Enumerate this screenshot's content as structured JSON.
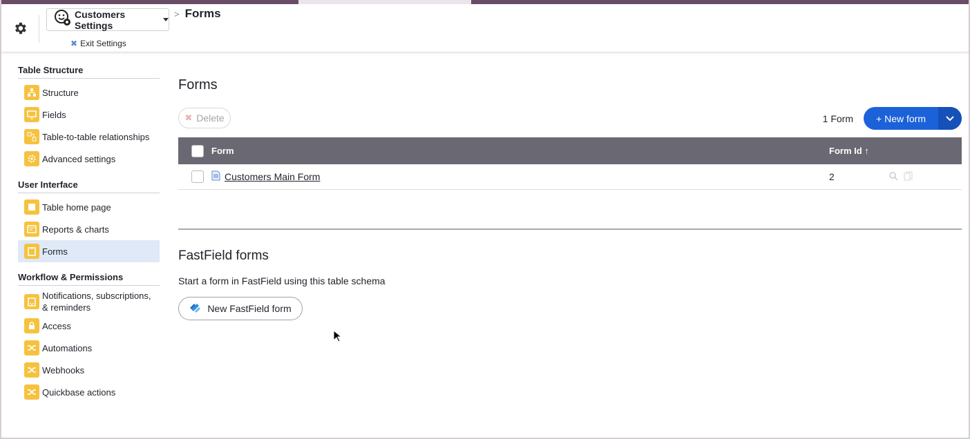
{
  "header": {
    "app_name": "Customers Settings",
    "exit_label": "Exit Settings",
    "breadcrumb_separator": ">",
    "breadcrumb_current": "Forms"
  },
  "sidebar": {
    "sections": [
      {
        "title": "Table Structure",
        "items": [
          {
            "label": "Structure",
            "icon": "structure-icon"
          },
          {
            "label": "Fields",
            "icon": "fields-icon"
          },
          {
            "label": "Table-to-table relationships",
            "icon": "relationships-icon"
          },
          {
            "label": "Advanced settings",
            "icon": "settings-gear-icon"
          }
        ]
      },
      {
        "title": "User Interface",
        "items": [
          {
            "label": "Table home page",
            "icon": "home-page-icon"
          },
          {
            "label": "Reports & charts",
            "icon": "reports-icon"
          },
          {
            "label": "Forms",
            "icon": "forms-icon",
            "active": true
          }
        ]
      },
      {
        "title": "Workflow & Permissions",
        "items": [
          {
            "label": "Notifications, subscriptions,",
            "label2": "& reminders",
            "icon": "notifications-icon"
          },
          {
            "label": "Access",
            "icon": "access-icon"
          },
          {
            "label": "Automations",
            "icon": "automations-icon"
          },
          {
            "label": "Webhooks",
            "icon": "webhooks-icon"
          },
          {
            "label": "Quickbase actions",
            "icon": "quickbase-actions-icon"
          }
        ]
      }
    ]
  },
  "main": {
    "title": "Forms",
    "delete_label": "Delete",
    "form_count": "1 Form",
    "new_form_label": "+ New form",
    "table": {
      "columns": [
        "Form",
        "Form Id"
      ],
      "sort_indicator": "↑",
      "rows": [
        {
          "name": "Customers Main Form",
          "id": "2"
        }
      ]
    },
    "fastfield": {
      "title": "FastField forms",
      "description": "Start a form in FastField using this table schema",
      "button_label": "New FastField form"
    }
  },
  "colors": {
    "accent": "#1b62d9",
    "header_row": "#6a6872",
    "icon_bg": "#f6c23e",
    "active_nav": "#dfe9f7"
  }
}
